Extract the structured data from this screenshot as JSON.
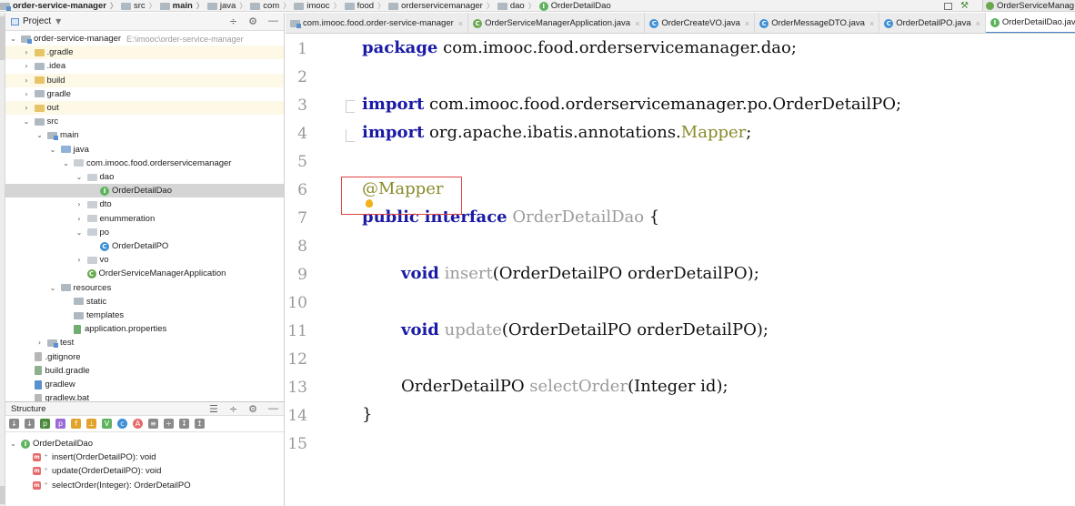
{
  "breadcrumb": {
    "items": [
      {
        "label": "order-service-manager",
        "bold": true,
        "icon": "module-icon"
      },
      {
        "label": "src",
        "icon": "folder-icon"
      },
      {
        "label": "main",
        "bold": true,
        "icon": "folder-icon"
      },
      {
        "label": "java",
        "icon": "folder-icon"
      },
      {
        "label": "com",
        "icon": "folder-icon"
      },
      {
        "label": "imooc",
        "icon": "folder-icon"
      },
      {
        "label": "food",
        "icon": "folder-icon"
      },
      {
        "label": "orderservicemanager",
        "icon": "folder-icon"
      },
      {
        "label": "dao",
        "icon": "folder-icon"
      },
      {
        "label": "OrderDetailDao",
        "icon": "interface-icon"
      }
    ],
    "run_config": "OrderServiceManag"
  },
  "project_panel": {
    "title": "Project",
    "rows": [
      {
        "depth": 0,
        "arrow": "down",
        "label": "order-service-manager",
        "path": "E:\\imooc\\order-service-manager",
        "icon": "module-icon"
      },
      {
        "depth": 1,
        "arrow": "right",
        "label": ".gradle",
        "icon": "folder-yellow-icon",
        "hl": true
      },
      {
        "depth": 1,
        "arrow": "right",
        "label": ".idea",
        "icon": "folder-icon"
      },
      {
        "depth": 1,
        "arrow": "right",
        "label": "build",
        "icon": "folder-yellow-icon",
        "hl": true
      },
      {
        "depth": 1,
        "arrow": "right",
        "label": "gradle",
        "icon": "folder-icon"
      },
      {
        "depth": 1,
        "arrow": "right",
        "label": "out",
        "icon": "folder-yellow-icon",
        "hl": true
      },
      {
        "depth": 1,
        "arrow": "down",
        "label": "src",
        "icon": "folder-icon"
      },
      {
        "depth": 2,
        "arrow": "down",
        "label": "main",
        "icon": "module-icon"
      },
      {
        "depth": 3,
        "arrow": "down",
        "label": "java",
        "icon": "folder-blue-icon"
      },
      {
        "depth": 4,
        "arrow": "down",
        "label": "com.imooc.food.orderservicemanager",
        "icon": "package-icon"
      },
      {
        "depth": 5,
        "arrow": "down",
        "label": "dao",
        "icon": "package-icon"
      },
      {
        "depth": 6,
        "arrow": "",
        "label": "OrderDetailDao",
        "icon": "interface-icon",
        "selected": true
      },
      {
        "depth": 5,
        "arrow": "right",
        "label": "dto",
        "icon": "package-icon"
      },
      {
        "depth": 5,
        "arrow": "right",
        "label": "enummeration",
        "icon": "package-icon"
      },
      {
        "depth": 5,
        "arrow": "down",
        "label": "po",
        "icon": "package-icon"
      },
      {
        "depth": 6,
        "arrow": "",
        "label": "OrderDetailPO",
        "icon": "class-icon"
      },
      {
        "depth": 5,
        "arrow": "right",
        "label": "vo",
        "icon": "package-icon"
      },
      {
        "depth": 5,
        "arrow": "",
        "label": "OrderServiceManagerApplication",
        "icon": "spring-boot-icon"
      },
      {
        "depth": 3,
        "arrow": "down",
        "label": "resources",
        "icon": "folder-icon"
      },
      {
        "depth": 4,
        "arrow": "",
        "label": "static",
        "icon": "folder-icon"
      },
      {
        "depth": 4,
        "arrow": "",
        "label": "templates",
        "icon": "folder-icon"
      },
      {
        "depth": 4,
        "arrow": "",
        "label": "application.properties",
        "icon": "properties-icon"
      },
      {
        "depth": 2,
        "arrow": "right",
        "label": "test",
        "icon": "module-icon"
      },
      {
        "depth": 1,
        "arrow": "",
        "label": ".gitignore",
        "icon": "file-icon"
      },
      {
        "depth": 1,
        "arrow": "",
        "label": "build.gradle",
        "icon": "gradle-file-icon"
      },
      {
        "depth": 1,
        "arrow": "",
        "label": "gradlew",
        "icon": "script-icon"
      },
      {
        "depth": 1,
        "arrow": "",
        "label": "gradlew.bat",
        "icon": "file-icon"
      }
    ]
  },
  "structure_panel": {
    "title": "Structure",
    "root": "OrderDetailDao",
    "members": [
      "insert(OrderDetailPO): void",
      "update(OrderDetailPO): void",
      "selectOrder(Integer): OrderDetailPO"
    ]
  },
  "editor": {
    "tabs": [
      {
        "label": "com.imooc.food.order-service-manager",
        "icon": "module-icon"
      },
      {
        "label": "OrderServiceManagerApplication.java",
        "icon": "spring-boot-icon"
      },
      {
        "label": "OrderCreateVO.java",
        "icon": "class-icon"
      },
      {
        "label": "OrderMessageDTO.java",
        "icon": "class-icon"
      },
      {
        "label": "OrderDetailPO.java",
        "icon": "class-icon"
      },
      {
        "label": "OrderDetailDao.java",
        "icon": "interface-icon",
        "active": true
      }
    ],
    "line_numbers": [
      "1",
      "2",
      "3",
      "4",
      "5",
      "6",
      "7",
      "8",
      "9",
      "10",
      "11",
      "12",
      "13",
      "14",
      "15"
    ],
    "code": {
      "l1_kw": "package",
      "l1_rest": " com.imooc.food.orderservicemanager.dao;",
      "l3_kw": "import",
      "l3_rest": " com.imooc.food.orderservicemanager.po.OrderDetailPO;",
      "l4_kw": "import",
      "l4_rest": " org.apache.ibatis.annotations.",
      "l4_ann": "Mapper",
      "l4_end": ";",
      "l6_ann": "@Mapper",
      "l7_kw1": "public",
      "l7_kw2": "interface",
      "l7_name": "OrderDetailDao",
      "l7_end": " {",
      "l9_kw": "void",
      "l9_m": "insert",
      "l9_rest": "(OrderDetailPO orderDetailPO);",
      "l11_kw": "void",
      "l11_m": "update",
      "l11_rest": "(OrderDetailPO orderDetailPO);",
      "l13_type": "OrderDetailPO ",
      "l13_m": "selectOrder",
      "l13_rest": "(Integer id);",
      "l14": "}"
    }
  }
}
